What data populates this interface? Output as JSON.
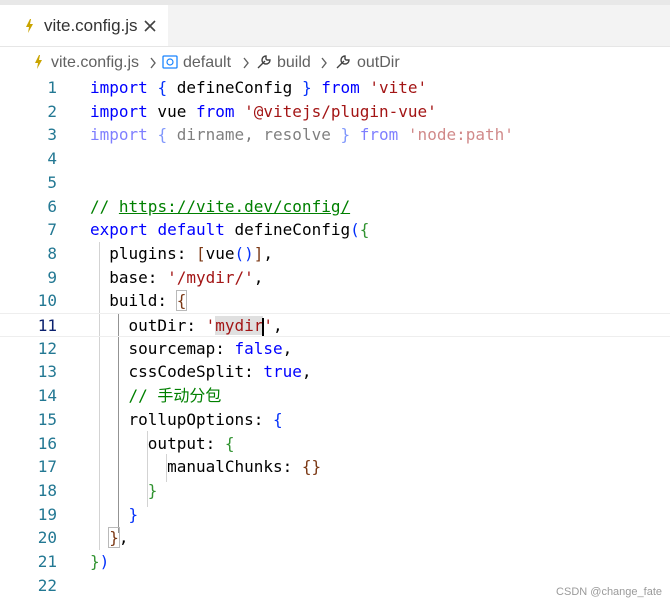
{
  "tab": {
    "filename": "vite.config.js",
    "icon": "js-file-icon",
    "close_icon": "close-icon"
  },
  "breadcrumb": {
    "items": [
      {
        "label": "vite.config.js",
        "icon": "js-file-icon"
      },
      {
        "label": "default",
        "icon": "module-icon"
      },
      {
        "label": "build",
        "icon": "wrench-icon"
      },
      {
        "label": "outDir",
        "icon": "wrench-icon"
      }
    ]
  },
  "editor": {
    "active_line": 11,
    "lines": [
      {
        "n": "1",
        "tokens": [
          [
            "k",
            "import"
          ],
          [
            "",
            "&nbsp;"
          ],
          [
            "b1",
            "{"
          ],
          [
            "",
            "&nbsp;defineConfig&nbsp;"
          ],
          [
            "b1",
            "}"
          ],
          [
            "",
            "&nbsp;"
          ],
          [
            "k",
            "from"
          ],
          [
            "",
            "&nbsp;"
          ],
          [
            "s",
            "'vite'"
          ]
        ]
      },
      {
        "n": "2",
        "tokens": [
          [
            "k",
            "import"
          ],
          [
            "",
            "&nbsp;vue&nbsp;"
          ],
          [
            "k",
            "from"
          ],
          [
            "",
            "&nbsp;"
          ],
          [
            "s",
            "'@vitejs/plugin-vue'"
          ]
        ]
      },
      {
        "n": "3",
        "faded": true,
        "tokens": [
          [
            "k",
            "import"
          ],
          [
            "",
            "&nbsp;"
          ],
          [
            "b1",
            "{"
          ],
          [
            "",
            "&nbsp;dirname,&nbsp;resolve&nbsp;"
          ],
          [
            "b1",
            "}"
          ],
          [
            "",
            "&nbsp;"
          ],
          [
            "k",
            "from"
          ],
          [
            "",
            "&nbsp;"
          ],
          [
            "s",
            "'node:path'"
          ]
        ]
      },
      {
        "n": "4",
        "tokens": []
      },
      {
        "n": "5",
        "tokens": []
      },
      {
        "n": "6",
        "tokens": [
          [
            "c",
            "//&nbsp;"
          ],
          [
            "c u",
            "https://vite.dev/config/"
          ]
        ]
      },
      {
        "n": "7",
        "tokens": [
          [
            "k",
            "export"
          ],
          [
            "",
            "&nbsp;"
          ],
          [
            "k",
            "default"
          ],
          [
            "",
            "&nbsp;defineConfig"
          ],
          [
            "b1",
            "("
          ],
          [
            "b2",
            "{"
          ]
        ]
      },
      {
        "n": "8",
        "tokens": [
          [
            "",
            "&nbsp;&nbsp;plugins:&nbsp;"
          ],
          [
            "b3",
            "["
          ],
          [
            "",
            "vue"
          ],
          [
            "b1",
            "()"
          ],
          [
            "b3",
            "]"
          ],
          [
            "",
            ","
          ]
        ]
      },
      {
        "n": "9",
        "tokens": [
          [
            "",
            "&nbsp;&nbsp;base:&nbsp;"
          ],
          [
            "s",
            "'/mydir/'"
          ],
          [
            "",
            ","
          ]
        ]
      },
      {
        "n": "10",
        "tokens": [
          [
            "",
            "&nbsp;&nbsp;build:&nbsp;"
          ],
          [
            "b3 match",
            "{"
          ]
        ]
      },
      {
        "n": "11",
        "tokens": [
          [
            "",
            "&nbsp;&nbsp;&nbsp;&nbsp;outDir:&nbsp;"
          ],
          [
            "s",
            "'"
          ],
          [
            "s hl",
            "mydir"
          ],
          [
            "cursor",
            ""
          ],
          [
            "s",
            "'"
          ],
          [
            "",
            ","
          ]
        ]
      },
      {
        "n": "12",
        "tokens": [
          [
            "",
            "&nbsp;&nbsp;&nbsp;&nbsp;sourcemap:&nbsp;"
          ],
          [
            "k",
            "false"
          ],
          [
            "",
            ","
          ]
        ]
      },
      {
        "n": "13",
        "tokens": [
          [
            "",
            "&nbsp;&nbsp;&nbsp;&nbsp;cssCodeSplit:&nbsp;"
          ],
          [
            "k",
            "true"
          ],
          [
            "",
            ","
          ]
        ]
      },
      {
        "n": "14",
        "tokens": [
          [
            "c",
            "&nbsp;&nbsp;&nbsp;&nbsp;//&nbsp;手动分包"
          ]
        ]
      },
      {
        "n": "15",
        "tokens": [
          [
            "",
            "&nbsp;&nbsp;&nbsp;&nbsp;rollupOptions:&nbsp;"
          ],
          [
            "b1",
            "{"
          ]
        ]
      },
      {
        "n": "16",
        "tokens": [
          [
            "",
            "&nbsp;&nbsp;&nbsp;&nbsp;&nbsp;&nbsp;output:&nbsp;"
          ],
          [
            "b2",
            "{"
          ]
        ]
      },
      {
        "n": "17",
        "tokens": [
          [
            "",
            "&nbsp;&nbsp;&nbsp;&nbsp;&nbsp;&nbsp;&nbsp;&nbsp;manualChunks:&nbsp;"
          ],
          [
            "b3",
            "{}"
          ]
        ]
      },
      {
        "n": "18",
        "tokens": [
          [
            "",
            "&nbsp;&nbsp;&nbsp;&nbsp;&nbsp;&nbsp;"
          ],
          [
            "b2",
            "}"
          ]
        ]
      },
      {
        "n": "19",
        "tokens": [
          [
            "",
            "&nbsp;&nbsp;&nbsp;&nbsp;"
          ],
          [
            "b1",
            "}"
          ]
        ]
      },
      {
        "n": "20",
        "tokens": [
          [
            "",
            "&nbsp;&nbsp;"
          ],
          [
            "b3 match",
            "}"
          ],
          [
            "",
            ","
          ]
        ]
      },
      {
        "n": "21",
        "tokens": [
          [
            "b2",
            "}"
          ],
          [
            "b1",
            ")"
          ]
        ]
      },
      {
        "n": "22",
        "tokens": []
      }
    ]
  },
  "watermark": "CSDN @change_fate"
}
